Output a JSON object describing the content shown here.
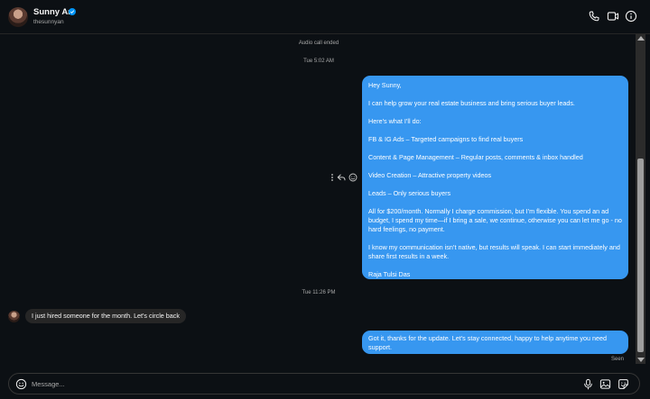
{
  "header": {
    "name": "Sunny An",
    "username": "thesunnyan",
    "icons": [
      "phone-icon",
      "video-camera-icon",
      "info-icon",
      "verified-badge-icon"
    ]
  },
  "thread": {
    "system_audio": "Audio call ended",
    "timestamp_1": "Tue 5:02 AM",
    "outgoing_1": {
      "p1": "Hey Sunny,",
      "p2": "I can help grow your real estate business and bring serious buyer leads.",
      "p3": "Here’s what I’ll do:",
      "p4": "FB & IG Ads – Targeted campaigns to find real buyers",
      "p5": "Content & Page Management – Regular posts, comments & inbox handled",
      "p6": "Video Creation – Attractive property videos",
      "p7": "Leads – Only serious buyers",
      "p8": "All for $200/month. Normally I charge commission, but I’m flexible. You spend an ad budget, I spend my time—if I bring a sale, we continue, otherwise you can let me go - no hard feelings, no payment.",
      "p9": "I know my communication isn’t native, but results will speak. I can start immediately and share first results in a week.",
      "p10": "Raja Tulsi Das"
    },
    "message_actions": [
      "more-options-icon",
      "reply-icon",
      "react-icon"
    ],
    "timestamp_2": "Tue 11:26 PM",
    "incoming_1": "I just hired someone for the month. Let's circle back",
    "outgoing_2": "Got it, thanks for the update. Let’s stay connected, happy to help anytime you need support.",
    "seen": "Seen"
  },
  "composer": {
    "placeholder": "Message...",
    "icons": [
      "emoji-icon",
      "microphone-icon",
      "image-icon",
      "sticker-icon"
    ]
  },
  "colors": {
    "background": "#0c1014",
    "outgoing_bubble": "#3797f0",
    "incoming_bubble": "#262626",
    "verified": "#0095f6"
  }
}
